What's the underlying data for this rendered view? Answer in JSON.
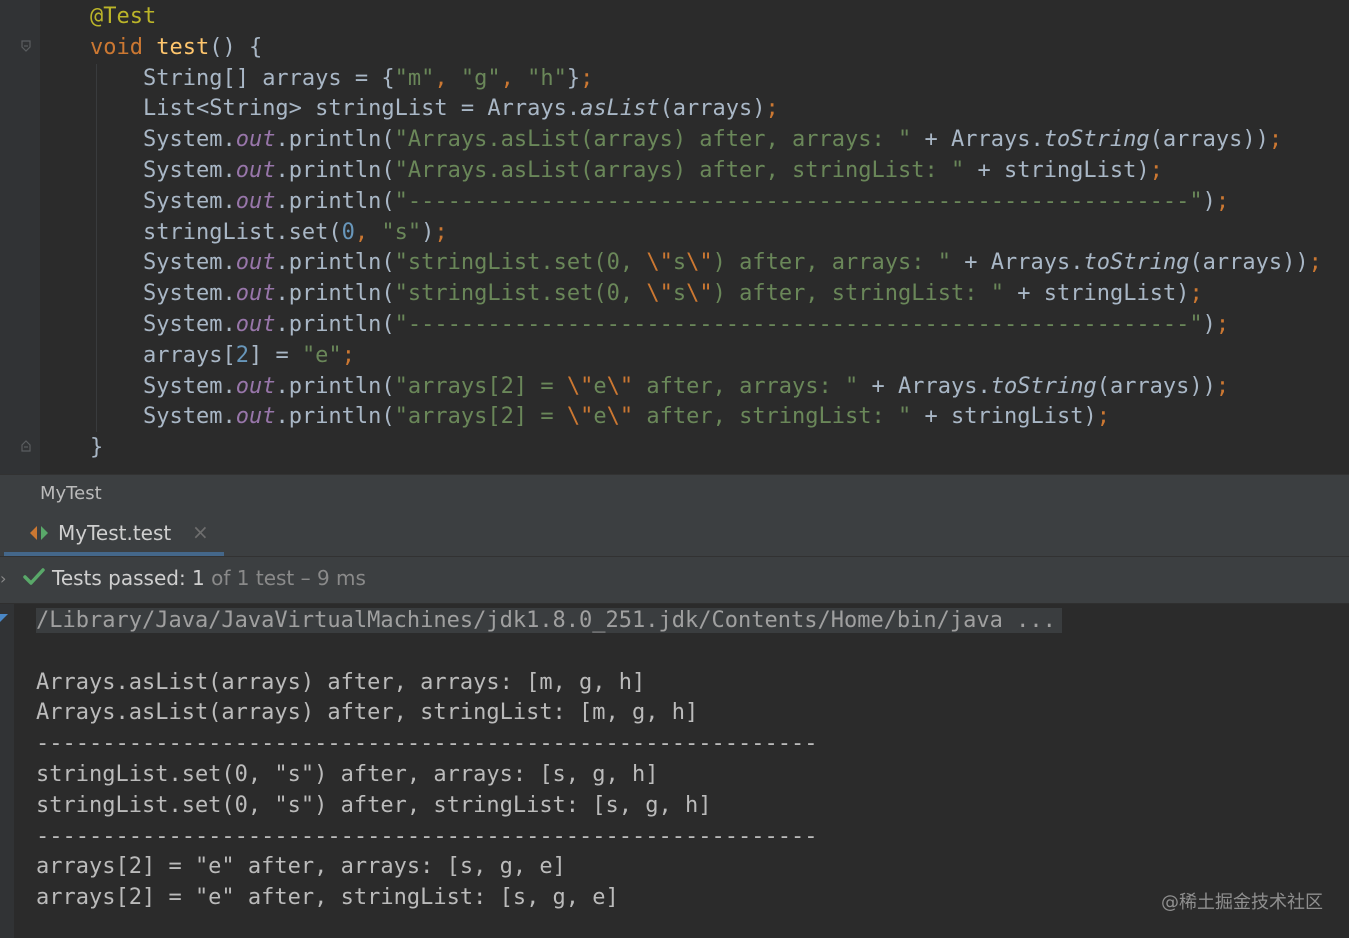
{
  "editor": {
    "annotation": "@Test",
    "signature": {
      "kw": "void",
      "name": "test",
      "rest": "() {"
    },
    "l3": {
      "a": "String[] arrays = {",
      "s1": "\"m\"",
      "c1": ", ",
      "s2": "\"g\"",
      "c2": ", ",
      "s3": "\"h\"",
      "b": "}",
      "semi": ";"
    },
    "l4": {
      "a": "List<String> stringList = Arrays.",
      "m": "asList",
      "b": "(arrays)",
      "semi": ";"
    },
    "l5": {
      "sys": "System.",
      "out": "out",
      "pr": ".println(",
      "s": "\"Arrays.asList(arrays) after, arrays: \"",
      "b": " + Arrays.",
      "m": "toString",
      "c": "(arrays))",
      "semi": ";"
    },
    "l6": {
      "sys": "System.",
      "out": "out",
      "pr": ".println(",
      "s": "\"Arrays.asList(arrays) after, stringList: \"",
      "b": " + stringList)",
      "semi": ";"
    },
    "l7": {
      "sys": "System.",
      "out": "out",
      "pr": ".println(",
      "s": "\"-----------------------------------------------------------\"",
      "b": ")",
      "semi": ";"
    },
    "l8": {
      "a": "stringList.set(",
      "n": "0",
      "c": ", ",
      "s": "\"s\"",
      "b": ")",
      "semi": ";"
    },
    "l9": {
      "sys": "System.",
      "out": "out",
      "pr": ".println(",
      "s1": "\"stringList.set(0, ",
      "e1": "\\\"",
      "s2": "s",
      "e2": "\\\"",
      "s3": ") after, arrays: \"",
      "b": " + Arrays.",
      "m": "toString",
      "c": "(arrays))",
      "semi": ";"
    },
    "l10": {
      "sys": "System.",
      "out": "out",
      "pr": ".println(",
      "s1": "\"stringList.set(0, ",
      "e1": "\\\"",
      "s2": "s",
      "e2": "\\\"",
      "s3": ") after, stringList: \"",
      "b": " + stringList)",
      "semi": ";"
    },
    "l11": {
      "sys": "System.",
      "out": "out",
      "pr": ".println(",
      "s": "\"-----------------------------------------------------------\"",
      "b": ")",
      "semi": ";"
    },
    "l12": {
      "a": "arrays[",
      "n": "2",
      "b": "] = ",
      "s": "\"e\"",
      "semi": ";"
    },
    "l13": {
      "sys": "System.",
      "out": "out",
      "pr": ".println(",
      "s1": "\"arrays[2] = ",
      "e1": "\\\"",
      "s2": "e",
      "e2": "\\\"",
      "s3": " after, arrays: \"",
      "b": " + Arrays.",
      "m": "toString",
      "c": "(arrays))",
      "semi": ";"
    },
    "l14": {
      "sys": "System.",
      "out": "out",
      "pr": ".println(",
      "s1": "\"arrays[2] = ",
      "e1": "\\\"",
      "s2": "e",
      "e2": "\\\"",
      "s3": " after, stringList: \"",
      "b": " + stringList)",
      "semi": ";"
    },
    "close": "}"
  },
  "run_panel": {
    "title": "MyTest",
    "tab_label": "MyTest.test",
    "tab_close": "×",
    "expand": "›",
    "status_bold": "Tests passed: 1",
    "status_rest": " of 1 test – 9 ms"
  },
  "console": {
    "command": "/Library/Java/JavaVirtualMachines/jdk1.8.0_251.jdk/Contents/Home/bin/java ...",
    "lines": [
      "",
      "Arrays.asList(arrays) after, arrays: [m, g, h]",
      "Arrays.asList(arrays) after, stringList: [m, g, h]",
      "-----------------------------------------------------------",
      "stringList.set(0, \"s\") after, arrays: [s, g, h]",
      "stringList.set(0, \"s\") after, stringList: [s, g, h]",
      "-----------------------------------------------------------",
      "arrays[2] = \"e\" after, arrays: [s, g, e]",
      "arrays[2] = \"e\" after, stringList: [s, g, e]"
    ]
  },
  "watermark": "@稀土掘金技术社区",
  "colors": {
    "background": "#2b2b2b",
    "keyword": "#cc7832",
    "string": "#6a8759",
    "annotation": "#bbb529",
    "function": "#ffc66d",
    "field": "#9876aa",
    "number": "#6897bb",
    "text": "#a9b7c6",
    "check": "#59a869"
  }
}
